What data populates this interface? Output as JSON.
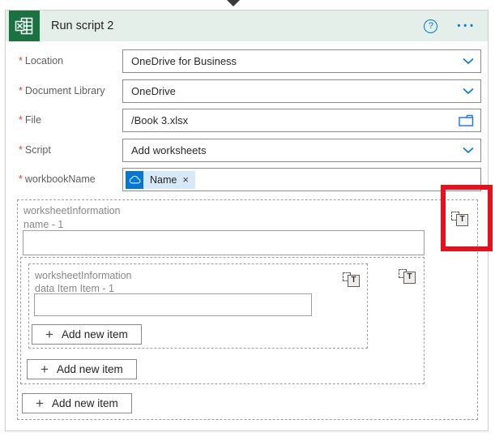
{
  "ui": {
    "required_marker": "*",
    "plus_glyph": "+",
    "help_glyph": "?",
    "menu_glyph": "•••",
    "close_glyph": "×",
    "t_icon_glyph": "T"
  },
  "colors": {
    "brand_green": "#1a7243",
    "accent_blue": "#0078d4",
    "header_bg": "#e4efe9",
    "token_bg": "#d7e9f9",
    "annotation_red": "#e8101c"
  },
  "header": {
    "title": "Run script 2"
  },
  "fields": {
    "location": {
      "label": "Location",
      "value": "OneDrive for Business",
      "control": "dropdown"
    },
    "document_library": {
      "label": "Document Library",
      "value": "OneDrive",
      "control": "dropdown"
    },
    "file": {
      "label": "File",
      "value": "/Book 3.xlsx",
      "control": "file-picker"
    },
    "script": {
      "label": "Script",
      "value": "Add worksheets",
      "control": "dropdown"
    },
    "workbook_name": {
      "label": "workbookName",
      "token_label": "Name",
      "token_icon": "onedrive-cloud-icon"
    }
  },
  "array_editor": {
    "outer": {
      "section_label": "worksheetInformation",
      "item_label": "name - 1",
      "input_value": "",
      "add_label": "Add new item"
    },
    "inner": {
      "section_label": "worksheetInformation",
      "item_label": "data Item Item - 1",
      "input_value": "",
      "add_label": "Add new item"
    },
    "root_add_label": "Add new item"
  }
}
